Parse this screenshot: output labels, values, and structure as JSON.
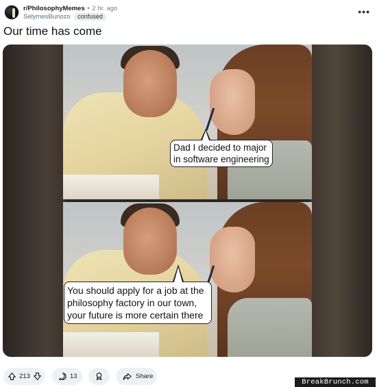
{
  "post": {
    "subreddit": "r/PhilosophyMemes",
    "separator": "•",
    "age": "2 hr. ago",
    "author": "SelymesBunozo",
    "flair": "confused",
    "title": "Our time has come",
    "more_label": "•••"
  },
  "meme": {
    "panel_top_caption": [
      "Dad I decided to major",
      "in software engineering"
    ],
    "panel_bottom_caption": [
      "You should apply for a job at the",
      "philosophy factory in our town,",
      "your future is more certain there"
    ]
  },
  "actions": {
    "upvotes": "213",
    "comments": "13",
    "share_label": "Share"
  },
  "watermark": "BreakBrunch.com",
  "colors": {
    "pill_bg": "#eef1f3",
    "flair_bg": "#e5ebee",
    "meta_gray": "#576f76"
  },
  "icons": [
    "subreddit-avatar-icon",
    "more-options-icon",
    "upvote-icon",
    "downvote-icon",
    "comment-icon",
    "award-icon",
    "share-icon"
  ]
}
